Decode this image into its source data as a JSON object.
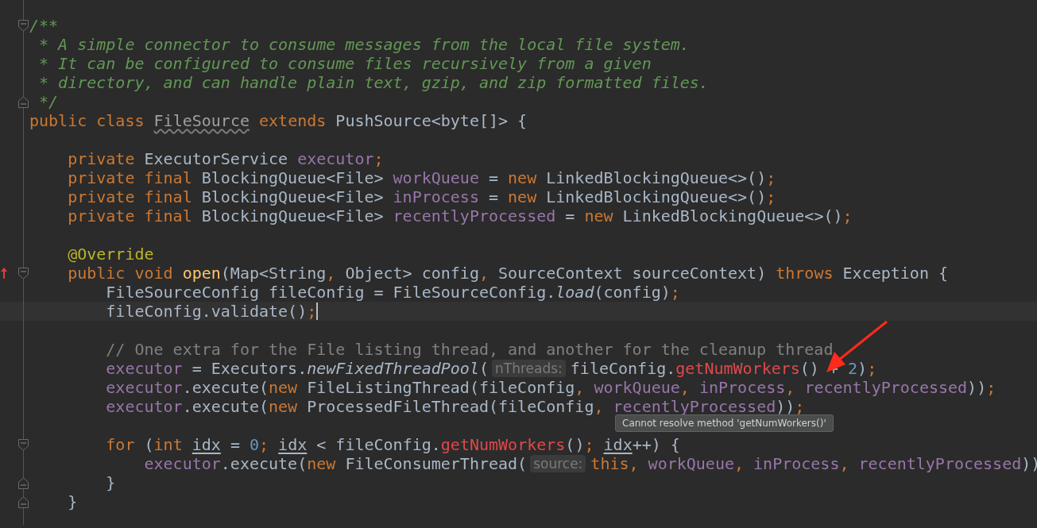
{
  "editor": {
    "lines": [
      {
        "kind": "blank"
      },
      {
        "kind": "code",
        "fold_start": true,
        "tokens": [
          {
            "kind": "doc",
            "text": "/**"
          }
        ]
      },
      {
        "kind": "code",
        "tokens": [
          {
            "kind": "doc",
            "text": " * A simple connector to consume messages from the local file system."
          }
        ]
      },
      {
        "kind": "code",
        "tokens": [
          {
            "kind": "doc",
            "text": " * It can be configured to consume files recursively from a given"
          }
        ]
      },
      {
        "kind": "code",
        "tokens": [
          {
            "kind": "doc",
            "text": " * directory, and can handle plain text, gzip, and zip formatted files."
          }
        ]
      },
      {
        "kind": "code",
        "fold_end": true,
        "tokens": [
          {
            "kind": "doc",
            "text": " */"
          }
        ]
      },
      {
        "kind": "code",
        "tokens": [
          {
            "kind": "keyword",
            "text": "public class "
          },
          {
            "kind": "unused",
            "text": "FileSource"
          },
          {
            "kind": "keyword",
            "text": " extends"
          },
          {
            "kind": "plain",
            "text": " PushSource<byte[]> {"
          }
        ]
      },
      {
        "kind": "blank"
      },
      {
        "kind": "code",
        "tokens": [
          {
            "kind": "keyword",
            "text": "    private "
          },
          {
            "kind": "plain",
            "text": "ExecutorService "
          },
          {
            "kind": "field",
            "text": "executor"
          },
          {
            "kind": "keyword",
            "text": ";"
          }
        ]
      },
      {
        "kind": "code",
        "tokens": [
          {
            "kind": "keyword",
            "text": "    private final "
          },
          {
            "kind": "plain",
            "text": "BlockingQueue<File> "
          },
          {
            "kind": "field",
            "text": "workQueue"
          },
          {
            "kind": "plain",
            "text": " = "
          },
          {
            "kind": "keyword",
            "text": "new "
          },
          {
            "kind": "plain",
            "text": "LinkedBlockingQueue<>()"
          },
          {
            "kind": "keyword",
            "text": ";"
          }
        ]
      },
      {
        "kind": "code",
        "tokens": [
          {
            "kind": "keyword",
            "text": "    private final "
          },
          {
            "kind": "plain",
            "text": "BlockingQueue<File> "
          },
          {
            "kind": "field",
            "text": "inProcess"
          },
          {
            "kind": "plain",
            "text": " = "
          },
          {
            "kind": "keyword",
            "text": "new "
          },
          {
            "kind": "plain",
            "text": "LinkedBlockingQueue<>()"
          },
          {
            "kind": "keyword",
            "text": ";"
          }
        ]
      },
      {
        "kind": "code",
        "tokens": [
          {
            "kind": "keyword",
            "text": "    private final "
          },
          {
            "kind": "plain",
            "text": "BlockingQueue<File> "
          },
          {
            "kind": "field",
            "text": "recentlyProcessed"
          },
          {
            "kind": "plain",
            "text": " = "
          },
          {
            "kind": "keyword",
            "text": "new "
          },
          {
            "kind": "plain",
            "text": "LinkedBlockingQueue<>()"
          },
          {
            "kind": "keyword",
            "text": ";"
          }
        ]
      },
      {
        "kind": "blank"
      },
      {
        "kind": "code",
        "tokens": [
          {
            "kind": "annotation",
            "text": "    @Override"
          }
        ]
      },
      {
        "kind": "code",
        "fold_start": true,
        "overrides": true,
        "tokens": [
          {
            "kind": "keyword",
            "text": "    public void "
          },
          {
            "kind": "method",
            "text": "open"
          },
          {
            "kind": "plain",
            "text": "(Map<String"
          },
          {
            "kind": "keyword",
            "text": ", "
          },
          {
            "kind": "plain",
            "text": "Object> config"
          },
          {
            "kind": "keyword",
            "text": ", "
          },
          {
            "kind": "plain",
            "text": "SourceContext sourceContext) "
          },
          {
            "kind": "keyword",
            "text": "throws "
          },
          {
            "kind": "plain",
            "text": "Exception {"
          }
        ]
      },
      {
        "kind": "code",
        "tokens": [
          {
            "kind": "plain",
            "text": "        FileSourceConfig fileConfig = FileSourceConfig."
          },
          {
            "kind": "static",
            "text": "load"
          },
          {
            "kind": "plain",
            "text": "(config)"
          },
          {
            "kind": "keyword",
            "text": ";"
          }
        ]
      },
      {
        "kind": "code",
        "current": true,
        "tokens": [
          {
            "kind": "plain",
            "text": "        fileConfig.validate()"
          },
          {
            "kind": "keyword",
            "text": ";"
          }
        ]
      },
      {
        "kind": "blank"
      },
      {
        "kind": "code",
        "tokens": [
          {
            "kind": "comment",
            "text": "        // One extra for the File listing thread, and another for the cleanup thread"
          }
        ]
      },
      {
        "kind": "code",
        "tokens": [
          {
            "kind": "field",
            "text": "        executor"
          },
          {
            "kind": "plain",
            "text": " = Executors."
          },
          {
            "kind": "static",
            "text": "newFixedThreadPool"
          },
          {
            "kind": "plain",
            "text": "("
          },
          {
            "kind": "hint",
            "text": "nThreads:"
          },
          {
            "kind": "plain",
            "text": "fileConfig."
          },
          {
            "kind": "error",
            "text": "getNumWorkers"
          },
          {
            "kind": "plain",
            "text": "() + "
          },
          {
            "kind": "number",
            "text": "2"
          },
          {
            "kind": "plain",
            "text": ")"
          },
          {
            "kind": "keyword",
            "text": ";"
          }
        ]
      },
      {
        "kind": "code",
        "tokens": [
          {
            "kind": "field",
            "text": "        executor"
          },
          {
            "kind": "plain",
            "text": ".execute("
          },
          {
            "kind": "keyword",
            "text": "new "
          },
          {
            "kind": "plain",
            "text": "FileListingThread(fileConfig"
          },
          {
            "kind": "keyword",
            "text": ", "
          },
          {
            "kind": "field",
            "text": "workQueue"
          },
          {
            "kind": "keyword",
            "text": ", "
          },
          {
            "kind": "field",
            "text": "inProcess"
          },
          {
            "kind": "keyword",
            "text": ", "
          },
          {
            "kind": "field",
            "text": "recentlyProcessed"
          },
          {
            "kind": "plain",
            "text": "))"
          },
          {
            "kind": "keyword",
            "text": ";"
          }
        ]
      },
      {
        "kind": "code",
        "tokens": [
          {
            "kind": "field",
            "text": "        executor"
          },
          {
            "kind": "plain",
            "text": ".execute("
          },
          {
            "kind": "keyword",
            "text": "new "
          },
          {
            "kind": "plain",
            "text": "ProcessedFileThread(fileConfig"
          },
          {
            "kind": "keyword",
            "text": ", "
          },
          {
            "kind": "field",
            "text": "recentlyProcessed"
          },
          {
            "kind": "plain",
            "text": "))"
          },
          {
            "kind": "keyword",
            "text": ";"
          }
        ]
      },
      {
        "kind": "blank"
      },
      {
        "kind": "code",
        "fold_start": true,
        "tokens": [
          {
            "kind": "keyword",
            "text": "        for "
          },
          {
            "kind": "plain",
            "text": "("
          },
          {
            "kind": "keyword",
            "text": "int "
          },
          {
            "kind": "variable",
            "text": "idx"
          },
          {
            "kind": "plain",
            "text": " = "
          },
          {
            "kind": "number",
            "text": "0"
          },
          {
            "kind": "keyword",
            "text": "; "
          },
          {
            "kind": "variable",
            "text": "idx"
          },
          {
            "kind": "plain",
            "text": " < fileConfig."
          },
          {
            "kind": "error",
            "text": "getNumWorkers"
          },
          {
            "kind": "plain",
            "text": "()"
          },
          {
            "kind": "keyword",
            "text": "; "
          },
          {
            "kind": "variable",
            "text": "idx"
          },
          {
            "kind": "plain",
            "text": "++) {"
          }
        ]
      },
      {
        "kind": "code",
        "tokens": [
          {
            "kind": "field",
            "text": "            executor"
          },
          {
            "kind": "plain",
            "text": ".execute("
          },
          {
            "kind": "keyword",
            "text": "new "
          },
          {
            "kind": "plain",
            "text": "FileConsumerThread("
          },
          {
            "kind": "hint",
            "text": "source:"
          },
          {
            "kind": "keyword",
            "text": "this, "
          },
          {
            "kind": "field",
            "text": "workQueue"
          },
          {
            "kind": "keyword",
            "text": ", "
          },
          {
            "kind": "field",
            "text": "inProcess"
          },
          {
            "kind": "keyword",
            "text": ", "
          },
          {
            "kind": "field",
            "text": "recentlyProcessed"
          },
          {
            "kind": "plain",
            "text": "))"
          }
        ]
      },
      {
        "kind": "code",
        "fold_end": true,
        "tokens": [
          {
            "kind": "plain",
            "text": "        }"
          }
        ]
      },
      {
        "kind": "code",
        "fold_end": true,
        "tokens": [
          {
            "kind": "plain",
            "text": "    }"
          }
        ]
      },
      {
        "kind": "blank"
      }
    ]
  },
  "tooltip": {
    "text": "Cannot resolve method 'getNumWorkers()'"
  }
}
